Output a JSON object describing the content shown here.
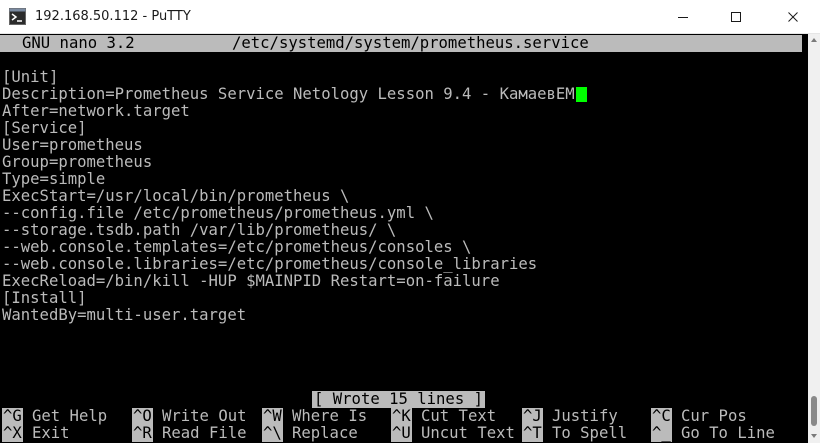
{
  "window": {
    "title": "192.168.50.112 - PuTTY",
    "icon": "putty-terminal-icon"
  },
  "nano": {
    "version": "GNU nano 3.2",
    "filename": "/etc/systemd/system/prometheus.service"
  },
  "file_lines": [
    "",
    "[Unit]",
    "Description=Prometheus Service Netology Lesson 9.4 - КамаевЕМ",
    "After=network.target",
    "[Service]",
    "User=prometheus",
    "Group=prometheus",
    "Type=simple",
    "ExecStart=/usr/local/bin/prometheus \\",
    "--config.file /etc/prometheus/prometheus.yml \\",
    "--storage.tsdb.path /var/lib/prometheus/ \\",
    "--web.console.templates=/etc/prometheus/consoles \\",
    "--web.console.libraries=/etc/prometheus/console_libraries",
    "ExecReload=/bin/kill -HUP $MAINPID Restart=on-failure",
    "[Install]",
    "WantedBy=multi-user.target"
  ],
  "status": "[ Wrote 15 lines ]",
  "shortcuts": {
    "row1": [
      {
        "key": "^G",
        "label": "Get Help"
      },
      {
        "key": "^O",
        "label": "Write Out"
      },
      {
        "key": "^W",
        "label": "Where Is"
      },
      {
        "key": "^K",
        "label": "Cut Text"
      },
      {
        "key": "^J",
        "label": "Justify"
      },
      {
        "key": "^C",
        "label": "Cur Pos"
      }
    ],
    "row2": [
      {
        "key": "^X",
        "label": "Exit"
      },
      {
        "key": "^R",
        "label": "Read File"
      },
      {
        "key": "^\\",
        "label": "Replace"
      },
      {
        "key": "^U",
        "label": "Uncut Text"
      },
      {
        "key": "^T",
        "label": "To Spell"
      },
      {
        "key": "^_",
        "label": "Go To Line"
      }
    ]
  },
  "colors": {
    "terminal_bg": "#000000",
    "terminal_fg": "#bbbbbb",
    "cursor": "#00ff00"
  }
}
